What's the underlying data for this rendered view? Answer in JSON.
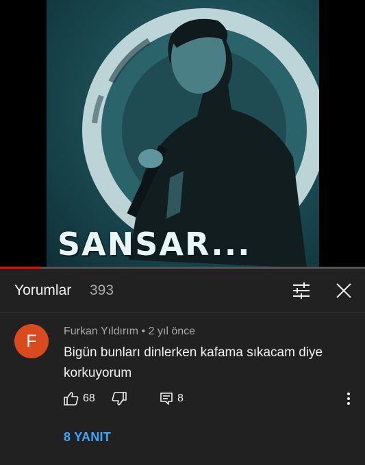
{
  "video": {
    "cover_text": "SANSAR...",
    "progress_fraction": 0.11,
    "progress_color": "#ff0000"
  },
  "comments": {
    "title": "Yorumlar",
    "count": "393",
    "filter_icon": "filter-sliders-icon",
    "close_icon": "close-x-icon"
  },
  "comment": {
    "avatar_letter": "F",
    "avatar_color": "#d94b1f",
    "author": "Furkan Yıldırım",
    "separator": "•",
    "time": "2 yıl önce",
    "text": "Bigün bunları dinlerken kafama sıkacam diye korkuyorum",
    "likes": "68",
    "replies_count": "8",
    "replies_link": "8 YANIT"
  },
  "colors": {
    "background": "#212121",
    "link": "#3ea6ff",
    "muted": "#aaaaaa"
  }
}
